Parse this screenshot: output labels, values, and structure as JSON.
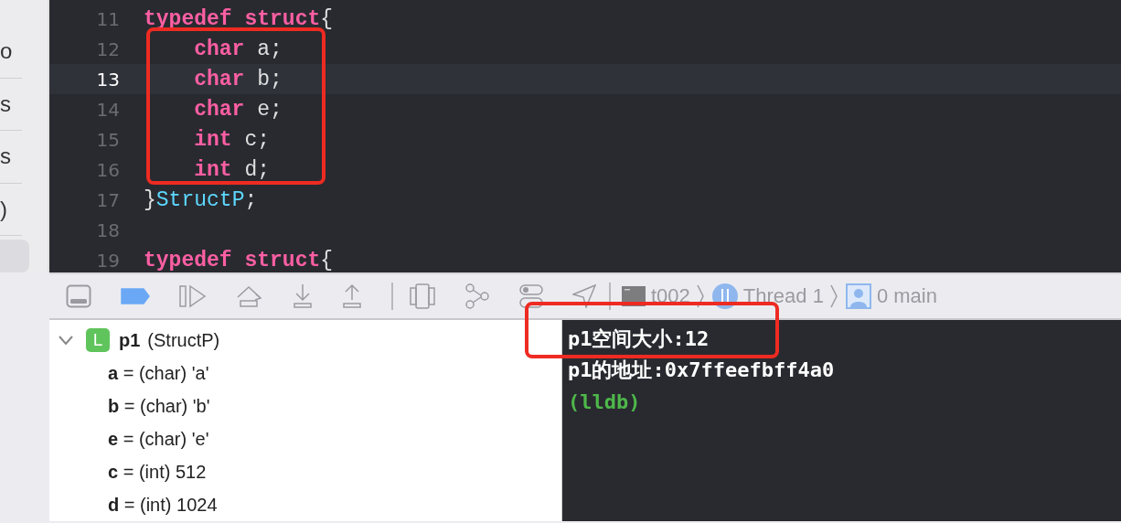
{
  "sidebar": {
    "items": [
      {
        "label": "o",
        "selected": false
      },
      {
        "label": "s",
        "selected": false
      },
      {
        "label": "s",
        "selected": false
      },
      {
        "label": ")",
        "selected": false
      },
      {
        "selected": true
      }
    ]
  },
  "editor": {
    "lines": [
      {
        "number": "11",
        "current": false,
        "tokens": [
          {
            "kind": "keyword",
            "text": "typedef struct"
          },
          {
            "kind": "plain",
            "text": "{"
          }
        ]
      },
      {
        "number": "12",
        "current": false,
        "tokens": [
          {
            "kind": "keyword",
            "text": "    char"
          },
          {
            "kind": "plain",
            "text": " a;"
          }
        ]
      },
      {
        "number": "13",
        "current": true,
        "tokens": [
          {
            "kind": "keyword",
            "text": "    char"
          },
          {
            "kind": "plain",
            "text": " b;"
          }
        ]
      },
      {
        "number": "14",
        "current": false,
        "tokens": [
          {
            "kind": "keyword",
            "text": "    char"
          },
          {
            "kind": "plain",
            "text": " e;"
          }
        ]
      },
      {
        "number": "15",
        "current": false,
        "tokens": [
          {
            "kind": "keyword",
            "text": "    int"
          },
          {
            "kind": "plain",
            "text": " c;"
          }
        ]
      },
      {
        "number": "16",
        "current": false,
        "tokens": [
          {
            "kind": "keyword",
            "text": "    int"
          },
          {
            "kind": "plain",
            "text": " d;"
          }
        ]
      },
      {
        "number": "17",
        "current": false,
        "tokens": [
          {
            "kind": "plain",
            "text": "}"
          },
          {
            "kind": "type",
            "text": "StructP"
          },
          {
            "kind": "plain",
            "text": ";"
          }
        ]
      },
      {
        "number": "18",
        "current": false
      },
      {
        "number": "19",
        "current": false,
        "tokens": [
          {
            "kind": "keyword",
            "text": "typedef struct"
          },
          {
            "kind": "plain",
            "text": "{"
          }
        ]
      }
    ]
  },
  "debug_bar": {
    "breakpoints_active": true,
    "breadcrumb": [
      {
        "kind": "app",
        "label": "t002"
      },
      {
        "kind": "thread",
        "label": "Thread 1"
      },
      {
        "kind": "frame",
        "label": "0 main"
      }
    ]
  },
  "variables": [
    {
      "name": "p1",
      "type": "(StructP)",
      "badge": "L",
      "expanded": true,
      "children": [
        {
          "text": "**a** = (char) 'a'"
        },
        {
          "text": "**b** = (char) 'b'"
        },
        {
          "text": "**e** = (char) 'e'"
        },
        {
          "text": "**c** = (int) 512"
        },
        {
          "text": "**d** = (int) 1024"
        }
      ]
    }
  ],
  "console": {
    "lines": [
      {
        "kind": "output",
        "text": "p1空间大小:12"
      },
      {
        "kind": "output",
        "text": "p1的地址:0x7ffeefbff4a0"
      },
      {
        "kind": "prompt",
        "text": "(lldb)"
      }
    ]
  },
  "annotations": [
    {
      "kind": "box"
    },
    {
      "kind": "box"
    }
  ]
}
